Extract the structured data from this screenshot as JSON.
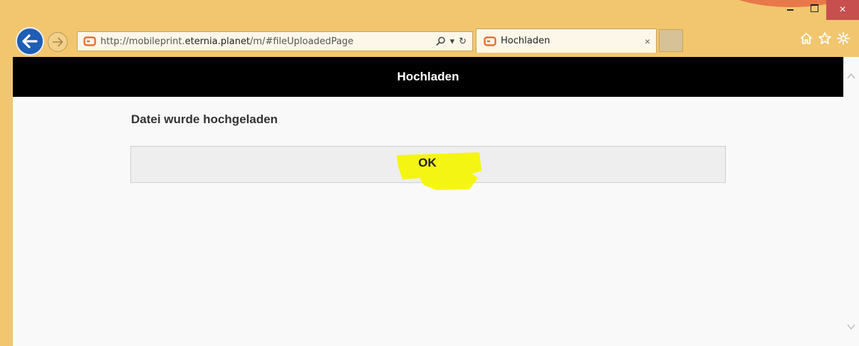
{
  "browser": {
    "address_bar": {
      "url_prefix": "http://mobileprint.",
      "url_host": "eternia.planet",
      "url_path": "/m/#fileUploadedPage",
      "search_glyph": "⌕",
      "dropdown_glyph": "▾",
      "refresh_glyph": "↻"
    },
    "tab": {
      "title": "Hochladen",
      "close_glyph": "×"
    },
    "window_controls": {
      "close_glyph": "×"
    },
    "icons": {
      "back": "back-arrow-icon",
      "forward": "forward-arrow-icon",
      "home": "home-icon",
      "favorites": "star-icon",
      "tools": "gear-icon"
    },
    "accent_color": "#1e5eb4",
    "frame_color": "#f1c66e"
  },
  "page": {
    "header_title": "Hochladen",
    "message": "Datei wurde hochgeladen",
    "ok_label": "OK",
    "highlight_color": "#f5f500"
  }
}
